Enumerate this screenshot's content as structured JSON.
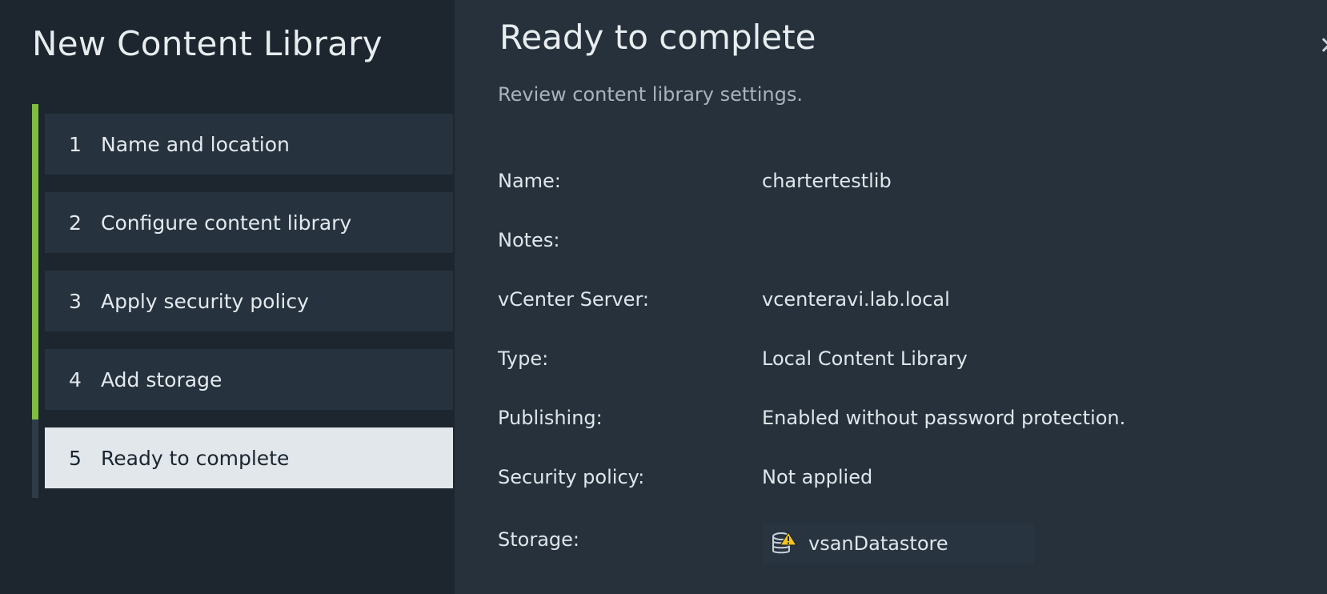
{
  "wizard": {
    "title": "New Content Library"
  },
  "progress": {
    "completed_fraction": 0.8
  },
  "steps": [
    {
      "number": "1",
      "label": "Name and location",
      "state": "completed"
    },
    {
      "number": "2",
      "label": "Configure content library",
      "state": "completed"
    },
    {
      "number": "3",
      "label": "Apply security policy",
      "state": "completed"
    },
    {
      "number": "4",
      "label": "Add storage",
      "state": "completed"
    },
    {
      "number": "5",
      "label": "Ready to complete",
      "state": "active"
    }
  ],
  "main": {
    "title": "Ready to complete",
    "subtitle": "Review content library settings.",
    "close_icon": "close-icon"
  },
  "summary": {
    "name": {
      "label": "Name:",
      "value": "chartertestlib"
    },
    "notes": {
      "label": "Notes:",
      "value": ""
    },
    "vcenter": {
      "label": "vCenter Server:",
      "value": "vcenteravi.lab.local"
    },
    "type": {
      "label": "Type:",
      "value": "Local Content Library"
    },
    "publishing": {
      "label": "Publishing:",
      "value": "Enabled without password protection."
    },
    "security_policy": {
      "label": "Security policy:",
      "value": "Not applied"
    },
    "storage": {
      "label": "Storage:",
      "value": "vsanDatastore",
      "icon": "datastore-warning-icon"
    }
  },
  "colors": {
    "progress_accent": "#7fbd41",
    "warning": "#f5c518",
    "active_step_bg": "#e2e7eb"
  }
}
